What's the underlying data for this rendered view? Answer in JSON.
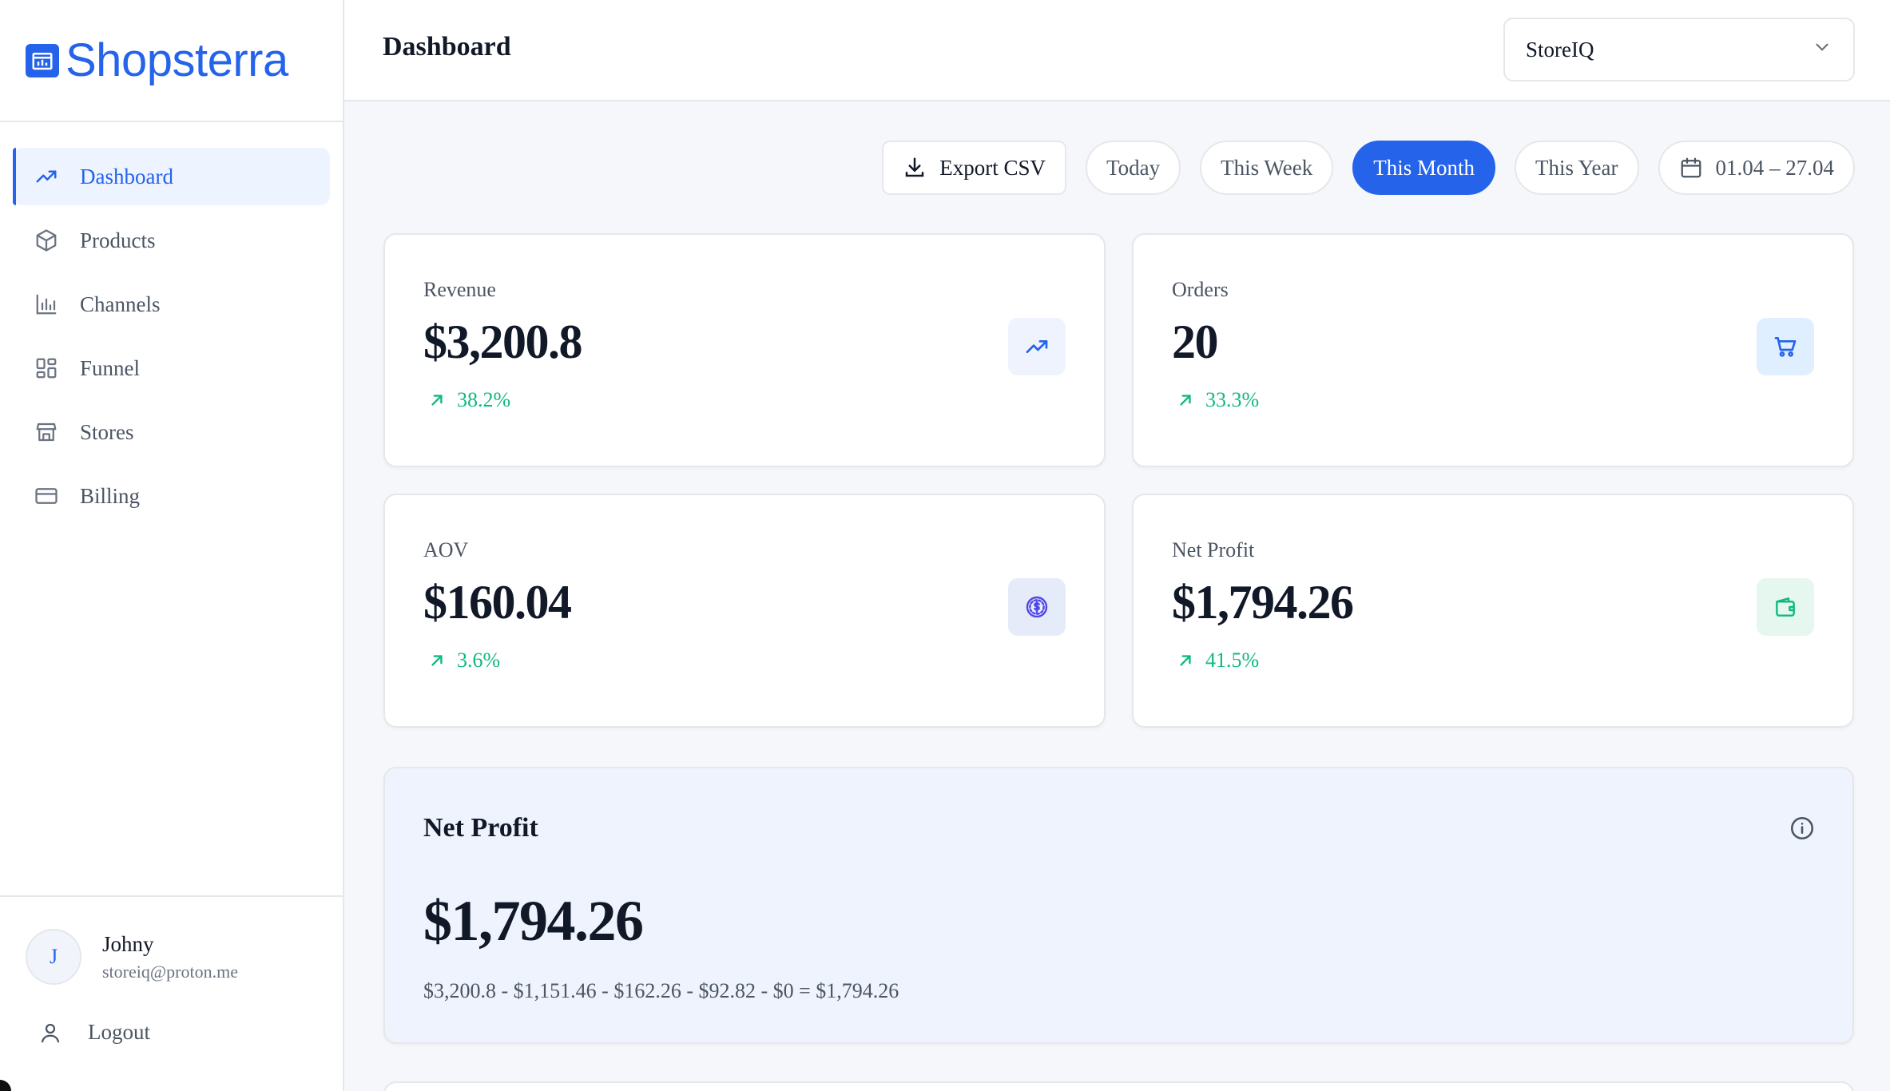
{
  "brand": {
    "name": "Shopsterra",
    "color": "#2563eb"
  },
  "sidebar": {
    "items": [
      {
        "label": "Dashboard",
        "icon": "trending-up-icon",
        "active": true
      },
      {
        "label": "Products",
        "icon": "box-icon"
      },
      {
        "label": "Channels",
        "icon": "bar-chart-icon"
      },
      {
        "label": "Funnel",
        "icon": "grid-icon"
      },
      {
        "label": "Stores",
        "icon": "store-icon"
      },
      {
        "label": "Billing",
        "icon": "credit-card-icon"
      }
    ]
  },
  "user": {
    "initial": "J",
    "name": "Johny",
    "email": "storeiq@proton.me",
    "logout_label": "Logout"
  },
  "header": {
    "title": "Dashboard",
    "store_select": {
      "value": "StoreIQ"
    }
  },
  "filters": {
    "export_label": "Export CSV",
    "today": "Today",
    "this_week": "This Week",
    "this_month": "This Month",
    "this_year": "This Year",
    "date_range": "01.04 – 27.04",
    "active": "This Month"
  },
  "kpis": {
    "revenue": {
      "label": "Revenue",
      "value": "$3,200.8",
      "change": "38.2%",
      "icon": "trending-up-icon"
    },
    "orders": {
      "label": "Orders",
      "value": "20",
      "change": "33.3%",
      "icon": "cart-icon"
    },
    "aov": {
      "label": "AOV",
      "value": "$160.04",
      "change": "3.6%",
      "icon": "dollar-circle-icon"
    },
    "net_profit": {
      "label": "Net Profit",
      "value": "$1,794.26",
      "change": "41.5%",
      "icon": "wallet-icon"
    }
  },
  "net_profit_panel": {
    "title": "Net Profit",
    "value": "$1,794.26",
    "formula": "$3,200.8 - $1,151.46 - $162.26 - $92.82 - $0 = $1,794.26"
  },
  "colors": {
    "accent": "#2563eb",
    "positive": "#10b981",
    "panel_bg": "#eef3fd"
  }
}
